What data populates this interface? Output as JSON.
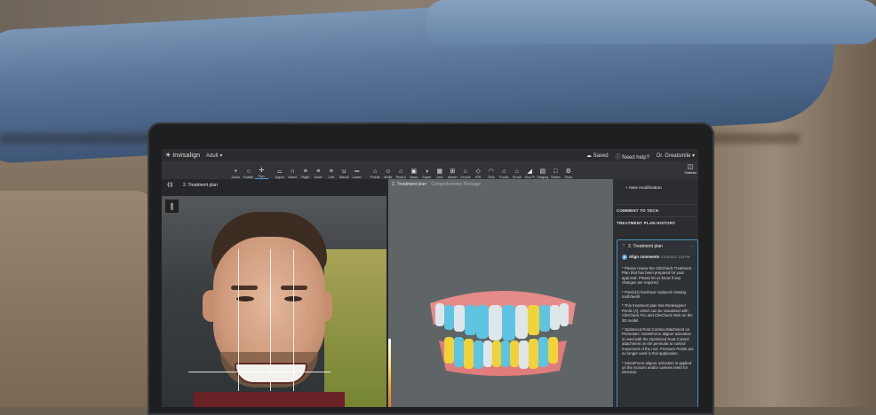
{
  "app": {
    "brand": "invisalign",
    "patient_type": "Adult ▾",
    "status_saved": "Saved",
    "help": "Need help?",
    "user": "Dr. Greatsmile ▾"
  },
  "toolbar": {
    "items": [
      {
        "label": "Zoom",
        "icon": "+"
      },
      {
        "label": "Rotate",
        "icon": "○"
      },
      {
        "label": "Pan",
        "icon": "✛"
      },
      {
        "label": "Upper",
        "icon": "⌓"
      },
      {
        "label": "Mand",
        "icon": "∩"
      },
      {
        "label": "Right",
        "icon": "≡"
      },
      {
        "label": "Anter",
        "icon": "≡"
      },
      {
        "label": "Left",
        "icon": "≡"
      },
      {
        "label": "Mandi",
        "icon": "∪"
      },
      {
        "label": "Lower",
        "icon": "═"
      },
      {
        "label": "Points",
        "icon": "⌂"
      },
      {
        "label": "Smile",
        "icon": "☺"
      },
      {
        "label": "Restor",
        "icon": "⌂"
      },
      {
        "label": "Mass",
        "icon": "▣"
      },
      {
        "label": "Super",
        "icon": "◑"
      },
      {
        "label": "Grid",
        "icon": "▦"
      },
      {
        "label": "Attach",
        "icon": "⊞"
      },
      {
        "label": "Occlus",
        "icon": "⌂"
      },
      {
        "label": "IPR",
        "icon": "◇"
      },
      {
        "label": "TMA",
        "icon": "◠"
      },
      {
        "label": "Pontic",
        "icon": "⌂"
      },
      {
        "label": "Email",
        "icon": "⌂"
      },
      {
        "label": "Sho Pl",
        "icon": "◢"
      },
      {
        "label": "Staging",
        "icon": "▤"
      },
      {
        "label": "Tables",
        "icon": "□"
      },
      {
        "label": "Tools",
        "icon": "⚙"
      }
    ],
    "sidebar_label": "Sidebar",
    "active_index": 2
  },
  "left_panel": {
    "nav_icon": "⟪⟫",
    "title": "2. Treatment plan",
    "photo_button_icon": "∥"
  },
  "center_panel": {
    "title": "2. Treatment plan",
    "subtitle": "Comprehensive Package"
  },
  "sidebar": {
    "new_modification": "+  New modification",
    "comment_to_tech": "COMMENT TO TECH",
    "history": "TREATMENT PLAN HISTORY",
    "card": {
      "chevron": "⌃",
      "title": "2. Treatment plan",
      "menu": "…",
      "avatar_initial": "A",
      "author": "Align comments",
      "date": "01/15/2022 1:04 PM",
      "paragraphs": [
        "* Please review the ClinCheck Treatment Plan that has been prepared for your approval. Please let us know if any changes are required.",
        "* Pontic(s) has/have replaced missing tooth/teeth.",
        "* This treatment plan has Redesigned Pontic (s), which can be visualized with ClinCheck Pro and ClinCheck Web on the 3D model.",
        "* Optimized Root Control Attachment on Premolars: SmartForce aligner activation is used with the Optimized Root Control attachment on the premolar to control movement of the root. Pressure Points are no longer used in this application.",
        "* SmartForce aligner activation is applied on the incisors and/or canines teeth for intrusion."
      ]
    }
  },
  "colors": {
    "accent": "#4aa3df",
    "tooth_white": "#dfe6ea",
    "tooth_blue": "#5ec4e2",
    "tooth_yellow": "#f0d23a",
    "gum": "#e48a8a"
  }
}
